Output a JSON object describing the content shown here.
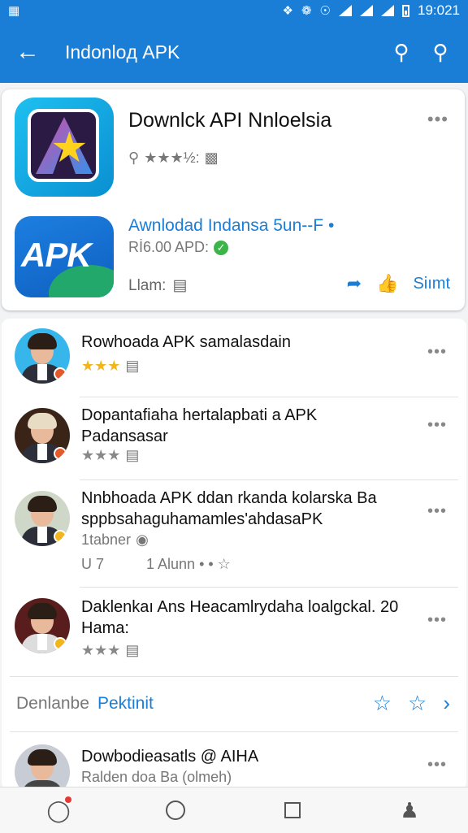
{
  "status_bar": {
    "time": "19:021"
  },
  "app_bar": {
    "back_icon": "arrow-left-icon",
    "title": "Indonloд APK",
    "search_icon": "search-icon",
    "search2_icon": "search-icon"
  },
  "featured": {
    "title": "Downlck API Nnloelsia",
    "more": "•••",
    "meta": "★★★½:",
    "app_icon_text": "APK",
    "link": "Awnlodad Indansa 5un--F •",
    "price": "Rİ6.00 APD:",
    "footer_label": "Llam:",
    "action_label": "Siımt",
    "colors": {
      "accent": "#1b7ed6",
      "success": "#3cb44a",
      "star": "#f2b51d"
    }
  },
  "list": {
    "items": [
      {
        "title": "Rowhoada APK samalasdain",
        "stars": "★★★",
        "stars_color": "yellow",
        "more": "•••"
      },
      {
        "title": "Dopantafiaha hertalapbati a APK Padansasar",
        "stars": "★★★",
        "stars_color": "grey",
        "more": "•••"
      },
      {
        "title": "Nnbhoada APK ddan rkanda kolarska Ba sppbsahaguhamamles'ahdasaPK",
        "sub1": "1tabner",
        "sub2": "1 Alunn • • ☆",
        "sub2_left": "U 7",
        "more": "•••"
      },
      {
        "title": "Daklenkaı Ans Heacamlrydaha loalgckal. 20 Hama:",
        "stars": "★★★",
        "stars_color": "grey",
        "more": "•••"
      }
    ],
    "see_all_label": "Denlanbe",
    "see_all_link": "Pektinit",
    "last_item": {
      "title": "Dowbodieasatls @ AIHA",
      "sub": "Ralden doa Ba (olmeh)",
      "more": "•••"
    }
  },
  "navbar": {
    "items": [
      {
        "name": "tag-icon"
      },
      {
        "name": "home-circle-icon"
      },
      {
        "name": "recents-square-icon"
      },
      {
        "name": "profile-icon"
      }
    ]
  }
}
